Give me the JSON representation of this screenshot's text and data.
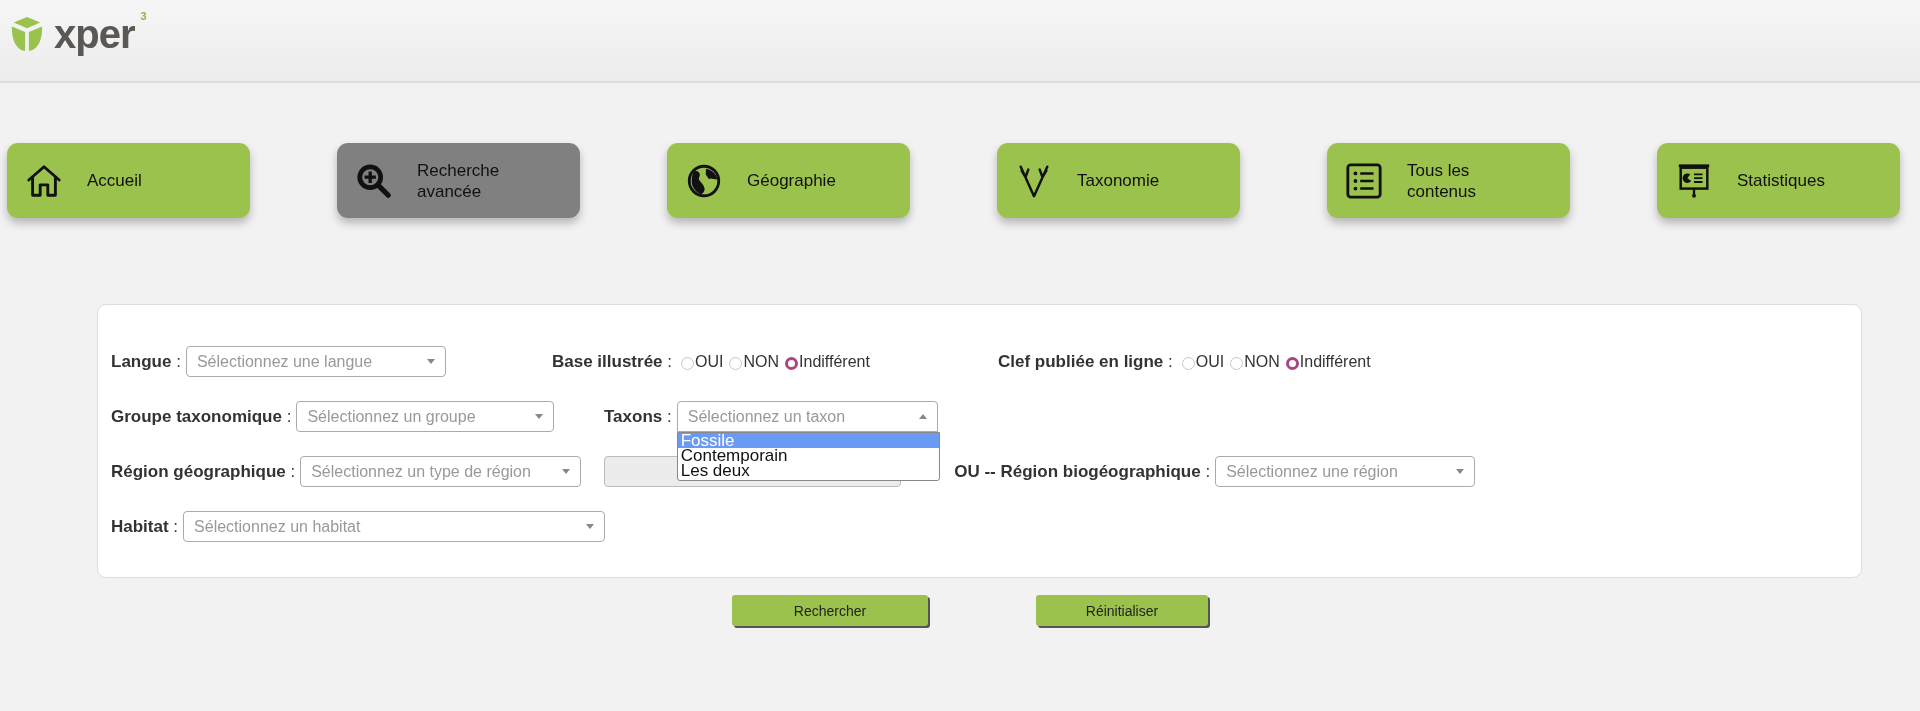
{
  "header": {
    "logo": {
      "name": "xper",
      "superscript": "3"
    }
  },
  "nav": [
    {
      "label": "Accueil",
      "selected": false
    },
    {
      "label": "Recherche avancée",
      "selected": true
    },
    {
      "label": "Géographie",
      "selected": false
    },
    {
      "label": "Taxonomie",
      "selected": false
    },
    {
      "label": "Tous les contenus",
      "selected": false
    },
    {
      "label": "Statistiques",
      "selected": false
    }
  ],
  "form": {
    "rows": [
      [
        {
          "kind": "select",
          "label": "**Langue** :",
          "placeholder": "Sélectionnez une langue",
          "expanded": false
        },
        {
          "kind": "radio",
          "label": "**Base illustrée** :",
          "options": [
            {
              "label": "OUI",
              "selected": false
            },
            {
              "label": "NON",
              "selected": false
            },
            {
              "label": "Indifférent",
              "selected": true
            }
          ]
        },
        {
          "kind": "radio",
          "label": "**Clef publiée en ligne** :",
          "options": [
            {
              "label": "OUI",
              "selected": false
            },
            {
              "label": "NON",
              "selected": false
            },
            {
              "label": "Indifférent",
              "selected": true
            }
          ]
        }
      ],
      [
        {
          "kind": "select",
          "label": "**Groupe taxonomique** :",
          "placeholder": "Sélectionnez un groupe",
          "expanded": false
        },
        {
          "kind": "select",
          "label": "**Taxons** :",
          "placeholder": "Sélectionnez un taxon",
          "expanded": true,
          "options": [
            {
              "label": "Fossile",
              "selected": true
            },
            {
              "label": "Contemporain",
              "selected": false
            },
            {
              "label": "Les deux",
              "selected": false
            }
          ]
        }
      ],
      [
        {
          "kind": "select",
          "label": "**Région géographique** :",
          "placeholder": "Sélectionnez un type de région",
          "expanded": false
        },
        {
          "kind": "field",
          "disabled": true
        },
        {
          "kind": "select",
          "label": "**OU -- Région biogéographique** :",
          "placeholder": "Sélectionnez une région",
          "expanded": false
        }
      ],
      [
        {
          "kind": "select",
          "label": "**Habitat** :",
          "placeholder": "Sélectionnez un habitat",
          "expanded": false
        }
      ]
    ]
  },
  "actions": [
    "Rechercher",
    "Réinitialiser"
  ]
}
